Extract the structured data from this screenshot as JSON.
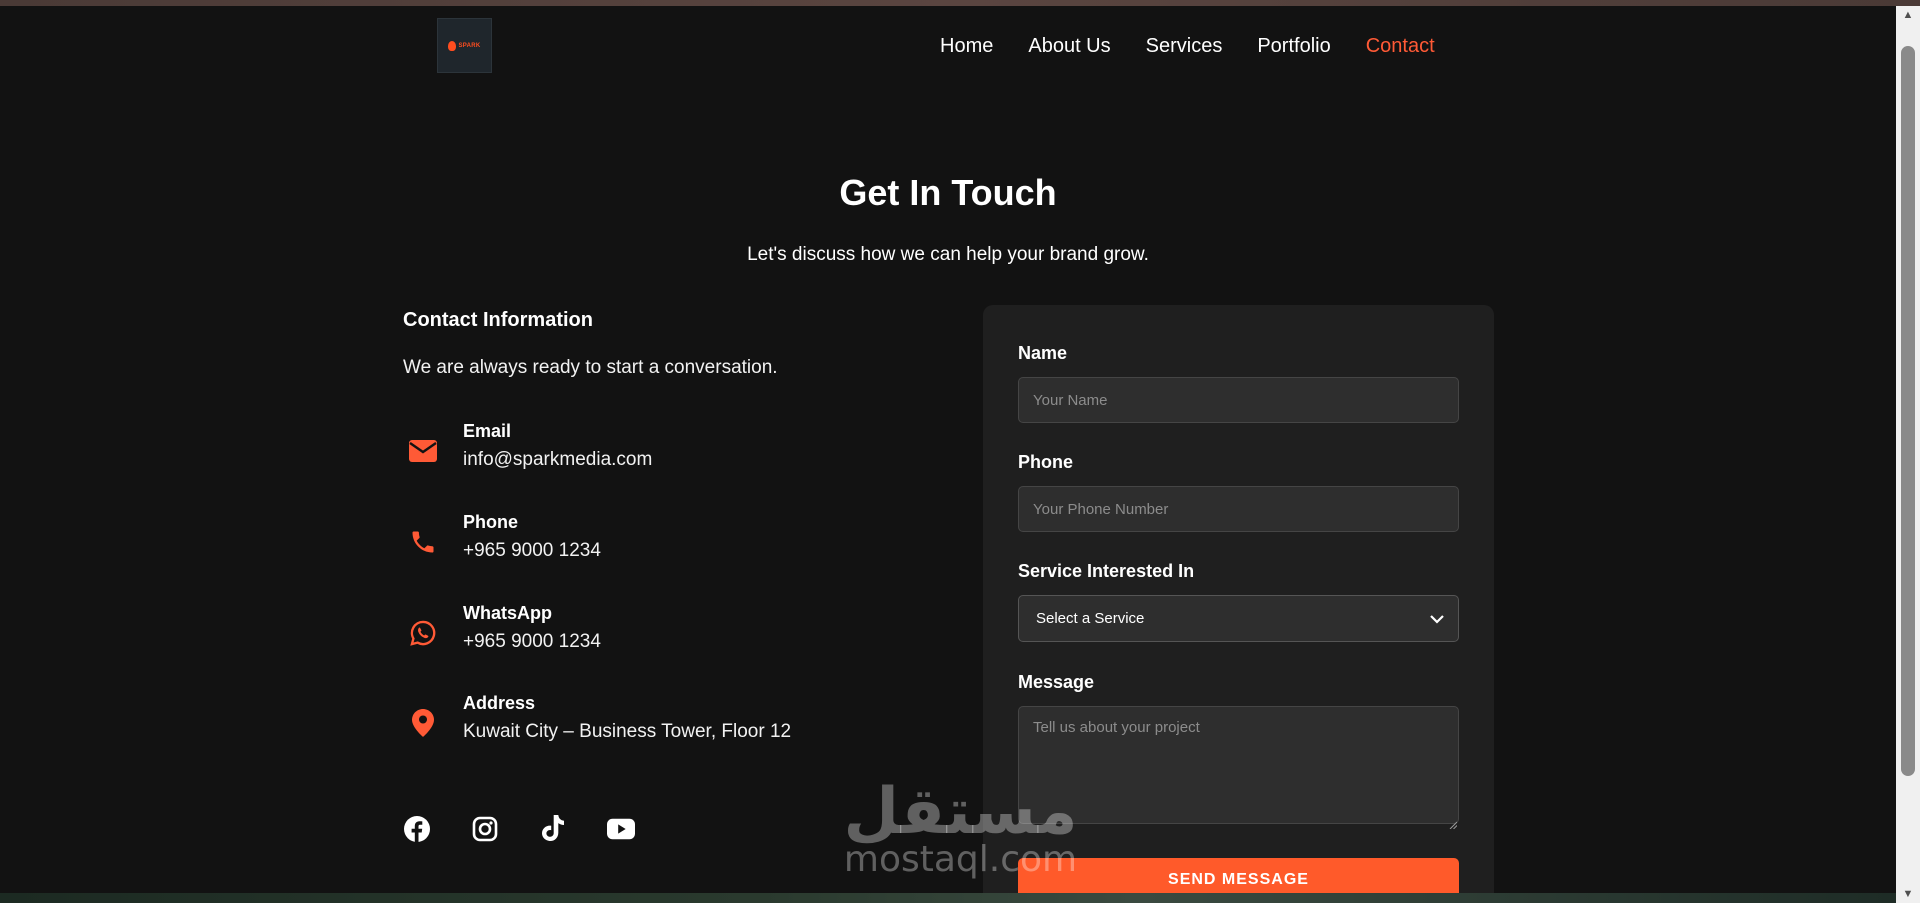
{
  "colors": {
    "background": "#121212",
    "accent": "#ff5a36",
    "card": "#1f1f1f",
    "input_bg": "#2e2e2e"
  },
  "header": {
    "logo_icon": "spark-media-logo",
    "nav": [
      {
        "label": "Home",
        "active": false
      },
      {
        "label": "About Us",
        "active": false
      },
      {
        "label": "Services",
        "active": false
      },
      {
        "label": "Portfolio",
        "active": false
      },
      {
        "label": "Contact",
        "active": true
      }
    ]
  },
  "hero": {
    "title": "Get In Touch",
    "subtitle": "Let's discuss how we can help your brand grow."
  },
  "contact_info": {
    "heading": "Contact Information",
    "intro": "We are always ready to start a conversation.",
    "items": [
      {
        "icon": "envelope-icon",
        "label": "Email",
        "value": "info@sparkmedia.com"
      },
      {
        "icon": "phone-icon",
        "label": "Phone",
        "value": "+965 9000 1234"
      },
      {
        "icon": "whatsapp-icon",
        "label": "WhatsApp",
        "value": "+965 9000 1234"
      },
      {
        "icon": "map-pin-icon",
        "label": "Address",
        "value": "Kuwait City – Business Tower, Floor 12"
      }
    ],
    "socials": [
      "facebook-icon",
      "instagram-icon",
      "tiktok-icon",
      "youtube-icon"
    ]
  },
  "form": {
    "name_label": "Name",
    "name_placeholder": "Your Name",
    "phone_label": "Phone",
    "phone_placeholder": "Your Phone Number",
    "service_label": "Service Interested In",
    "service_selected": "Select a Service",
    "message_label": "Message",
    "message_placeholder": "Tell us about your project",
    "submit_label": "SEND MESSAGE"
  },
  "watermark": {
    "arabic": "مستقل",
    "latin": "mostaql.com"
  }
}
